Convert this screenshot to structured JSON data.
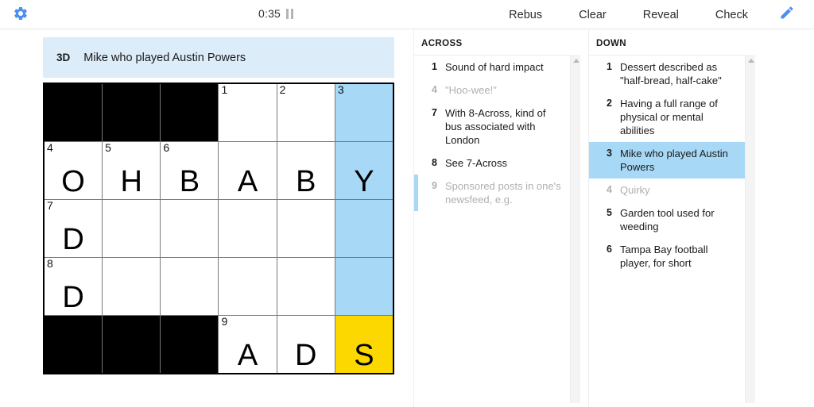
{
  "toolbar": {
    "settings_icon": "gear-icon",
    "timer": "0:35",
    "pause_icon": "pause-icon",
    "actions": [
      {
        "label": "Rebus"
      },
      {
        "label": "Clear"
      },
      {
        "label": "Reveal"
      },
      {
        "label": "Check"
      }
    ],
    "pencil_icon": "pencil-icon"
  },
  "current_clue": {
    "number": "3D",
    "text": "Mike who played Austin Powers"
  },
  "colors": {
    "accent_blue": "#4a90f0",
    "highlight_blue": "#a7d8f5",
    "clue_bar_blue": "#dcecf9",
    "active_cell_yellow": "#fcd700",
    "block_black": "#000000"
  },
  "grid": {
    "rows": 5,
    "cols": 6,
    "cells": [
      [
        {
          "type": "block"
        },
        {
          "type": "block"
        },
        {
          "type": "block"
        },
        {
          "type": "open",
          "number": "1",
          "letter": ""
        },
        {
          "type": "open",
          "number": "2",
          "letter": ""
        },
        {
          "type": "open",
          "number": "3",
          "letter": "",
          "state": "hl"
        }
      ],
      [
        {
          "type": "open",
          "number": "4",
          "letter": "O"
        },
        {
          "type": "open",
          "number": "5",
          "letter": "H"
        },
        {
          "type": "open",
          "number": "6",
          "letter": "B"
        },
        {
          "type": "open",
          "number": "",
          "letter": "A"
        },
        {
          "type": "open",
          "number": "",
          "letter": "B"
        },
        {
          "type": "open",
          "number": "",
          "letter": "Y",
          "state": "hl"
        }
      ],
      [
        {
          "type": "open",
          "number": "7",
          "letter": "D"
        },
        {
          "type": "open",
          "number": "",
          "letter": ""
        },
        {
          "type": "open",
          "number": "",
          "letter": ""
        },
        {
          "type": "open",
          "number": "",
          "letter": ""
        },
        {
          "type": "open",
          "number": "",
          "letter": ""
        },
        {
          "type": "open",
          "number": "",
          "letter": "",
          "state": "hl"
        }
      ],
      [
        {
          "type": "open",
          "number": "8",
          "letter": "D"
        },
        {
          "type": "open",
          "number": "",
          "letter": ""
        },
        {
          "type": "open",
          "number": "",
          "letter": ""
        },
        {
          "type": "open",
          "number": "",
          "letter": ""
        },
        {
          "type": "open",
          "number": "",
          "letter": ""
        },
        {
          "type": "open",
          "number": "",
          "letter": "",
          "state": "hl"
        }
      ],
      [
        {
          "type": "block"
        },
        {
          "type": "block"
        },
        {
          "type": "block"
        },
        {
          "type": "open",
          "number": "9",
          "letter": "A"
        },
        {
          "type": "open",
          "number": "",
          "letter": "D"
        },
        {
          "type": "open",
          "number": "",
          "letter": "S",
          "state": "active"
        }
      ]
    ]
  },
  "across": {
    "heading": "ACROSS",
    "clues": [
      {
        "number": "1",
        "text": "Sound of hard impact",
        "state": "normal"
      },
      {
        "number": "4",
        "text": "\"Hoo-wee!\"",
        "state": "done"
      },
      {
        "number": "7",
        "text": "With 8-Across, kind of bus associated with London",
        "state": "normal"
      },
      {
        "number": "8",
        "text": "See 7-Across",
        "state": "normal"
      },
      {
        "number": "9",
        "text": "Sponsored posts in one's newsfeed, e.g.",
        "state": "done-bar"
      }
    ]
  },
  "down": {
    "heading": "DOWN",
    "clues": [
      {
        "number": "1",
        "text": "Dessert described as \"half-bread, half-cake\"",
        "state": "normal"
      },
      {
        "number": "2",
        "text": "Having a full range of physical or mental abilities",
        "state": "normal"
      },
      {
        "number": "3",
        "text": "Mike who played Austin Powers",
        "state": "selected"
      },
      {
        "number": "4",
        "text": "Quirky",
        "state": "done"
      },
      {
        "number": "5",
        "text": "Garden tool used for weeding",
        "state": "normal"
      },
      {
        "number": "6",
        "text": "Tampa Bay football player, for short",
        "state": "normal"
      }
    ]
  }
}
